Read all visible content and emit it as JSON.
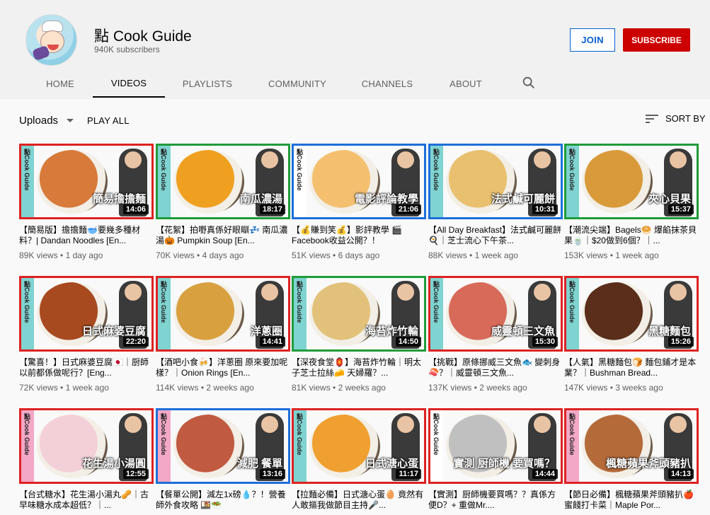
{
  "channel": {
    "name": "點 Cook Guide",
    "subscribers": "940K subscribers",
    "join_label": "JOIN",
    "subscribe_label": "SUBSCRIBE"
  },
  "tabs": [
    {
      "label": "HOME"
    },
    {
      "label": "VIDEOS"
    },
    {
      "label": "PLAYLISTS"
    },
    {
      "label": "COMMUNITY"
    },
    {
      "label": "CHANNELS"
    },
    {
      "label": "ABOUT"
    }
  ],
  "active_tab": "VIDEOS",
  "toolbar": {
    "uploads_label": "Uploads",
    "play_all_label": "PLAY ALL",
    "sort_label": "SORT BY"
  },
  "videos": [
    {
      "caption": "簡易擔擔麵",
      "duration": "14:06",
      "title": "【簡易版】擔擔麵🥣要幾多種材料？| Dandan Noodles [En...",
      "views": "89K views",
      "age": "1 day ago"
    },
    {
      "caption": "南瓜濃湯",
      "duration": "18:17",
      "title": "【花絮】拍嘢真係好眼瞓💤 南瓜濃湯🎃 Pumpkin Soup [En...",
      "views": "70K views",
      "age": "4 days ago"
    },
    {
      "caption": "電影評論教學",
      "duration": "21:06",
      "title": "【💰賺到笑💰】影評教學 🎬 Facebook收益公開？！",
      "views": "51K views",
      "age": "6 days ago"
    },
    {
      "caption": "法式鹹可麗餅",
      "duration": "10:31",
      "title": "【All Day Breakfast】法式鹹可麗餅 🍳｜芝士流心下午茶...",
      "views": "88K views",
      "age": "1 week ago"
    },
    {
      "caption": "夾心貝果",
      "duration": "15:37",
      "title": "【潮流尖端】Bagels🥯 爆餡抹茶貝果🍵｜$20做到6個？｜...",
      "views": "153K views",
      "age": "1 week ago"
    },
    {
      "caption": "日式麻婆豆腐",
      "duration": "22:20",
      "title": "【驚喜！】日式麻婆豆腐🇯🇵｜厨師以前都係做呢行？[Eng...",
      "views": "72K views",
      "age": "1 week ago"
    },
    {
      "caption": "洋蔥圈",
      "duration": "14:41",
      "title": "【酒吧小食🍻】洋蔥圈 原來要加呢樣？｜Onion Rings [En...",
      "views": "114K views",
      "age": "2 weeks ago"
    },
    {
      "caption": "海苔炸竹輪",
      "duration": "14:50",
      "title": "【深夜食堂🏮】海苔炸竹輪｜明太子芝士拉絲🧀 天婦羅？...",
      "views": "81K views",
      "age": "2 weeks ago"
    },
    {
      "caption": "威靈頓三文魚",
      "duration": "15:30",
      "title": "【挑戰】原條挪威三文魚🐟 變刺身🍣？｜威靈頓三文魚...",
      "views": "137K views",
      "age": "2 weeks ago"
    },
    {
      "caption": "黑糖麵包",
      "duration": "15:26",
      "title": "【人氣】黑糖麵包🍞 麵包鋪才是本業？｜Bushman Bread...",
      "views": "147K views",
      "age": "3 weeks ago"
    },
    {
      "caption": "花生湯小湯圓",
      "duration": "12:55",
      "title": "【台式糖水】花生湯小湯丸🥜｜古早味糖水成本超低？｜...",
      "views": "",
      "age": ""
    },
    {
      "caption": "減肥 餐單",
      "duration": "13:16",
      "title": "【餐單公開】減左1x磅💧？！營養師外食攻略 🍱🥗",
      "views": "",
      "age": ""
    },
    {
      "caption": "日式溏心蛋",
      "duration": "11:17",
      "title": "【拉麵必備】日式溏心蛋🥚 竟然有人敢摳我做節目主持🎤...",
      "views": "",
      "age": ""
    },
    {
      "caption": "實測 厨師機 要買嗎？",
      "duration": "14:44",
      "title": "【實測】厨師機要買嗎？？真係方便D？+ 重做Mr....",
      "views": "",
      "age": ""
    },
    {
      "caption": "楓糖蘋果斧頭豬扒",
      "duration": "14:13",
      "title": "【節日必備】楓糖蘋果斧頭豬扒🍎蜜餞打卡菜｜Maple Por...",
      "views": "",
      "age": ""
    }
  ],
  "colors": {
    "accent_red": "#cc0000",
    "join_blue": "#065fd4",
    "thumb_border_red": "#dd2222",
    "thumb_border_green": "#1f9c3a",
    "thumb_border_blue": "#1e6fd9",
    "side_teal": "#7fd3d0",
    "side_pink": "#f2a8c6"
  },
  "icons": {
    "search": "search-icon",
    "sort": "sort-icon",
    "caret": "caret-down-icon"
  }
}
